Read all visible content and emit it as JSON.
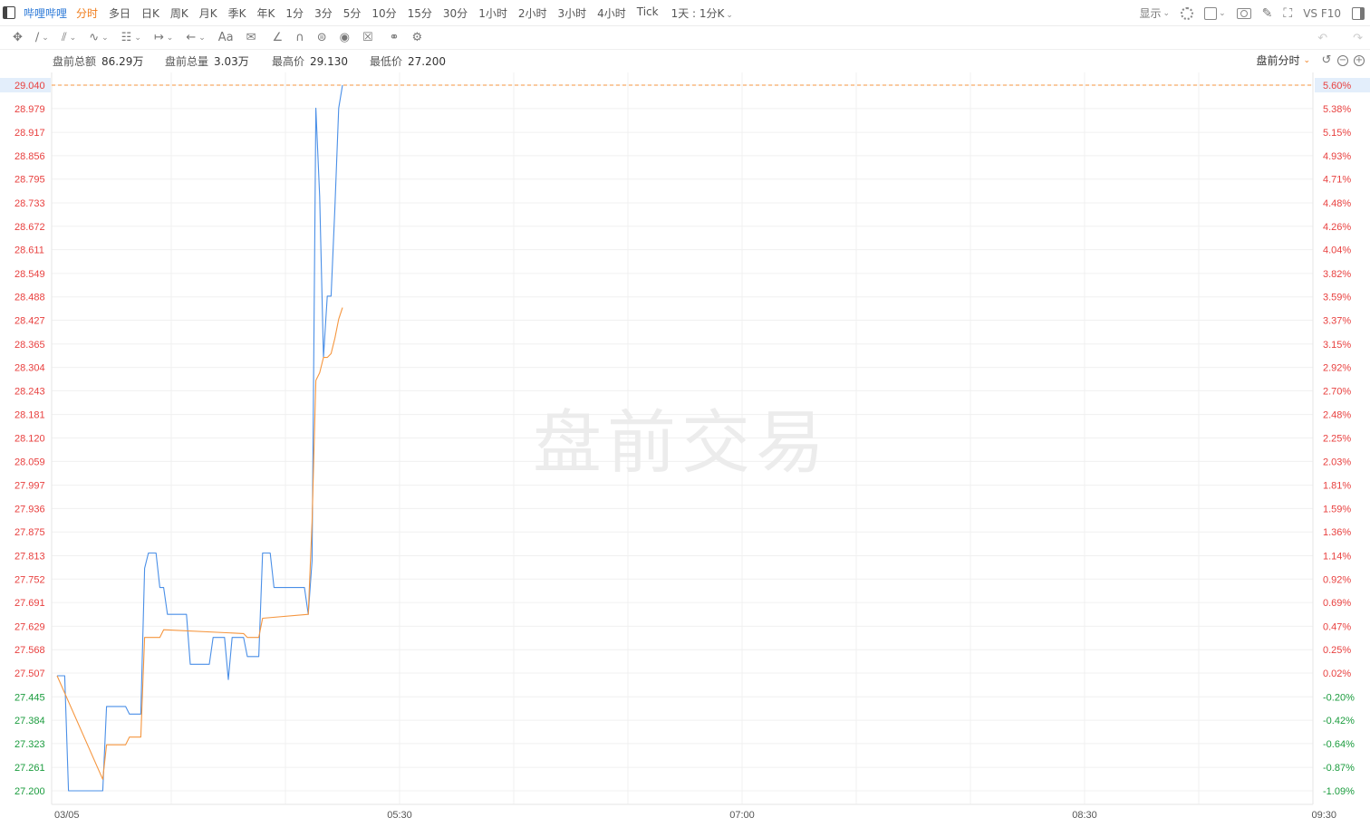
{
  "toolbar": {
    "stock_name": "哔哩哔哩",
    "periods": [
      "分时",
      "多日",
      "日K",
      "周K",
      "月K",
      "季K",
      "年K",
      "1分",
      "3分",
      "5分",
      "10分",
      "15分",
      "30分",
      "1小时",
      "2小时",
      "3小时",
      "4小时",
      "Tick"
    ],
    "active_period": "分时",
    "range_label": "1天 : 1分K",
    "display_label": "显示",
    "vs_f10_label": "VS F10"
  },
  "drawing_toolbar": {
    "text_tool_label": "Aa",
    "icons": [
      "move-icon",
      "line-icon",
      "channel-icon",
      "wave-icon",
      "measure-icon",
      "range-icon",
      "arrow-icon",
      "text-icon",
      "comment-icon",
      "angle-icon",
      "magnet-icon",
      "lock-icon",
      "eye-icon",
      "trash-icon",
      "compare-icon",
      "settings-icon"
    ]
  },
  "info": {
    "amount_label": "盘前总额",
    "amount_value": "86.29万",
    "volume_label": "盘前总量",
    "volume_value": "3.03万",
    "high_label": "最高价",
    "high_value": "29.130",
    "low_label": "最低价",
    "low_value": "27.200",
    "mode_label": "盘前分时"
  },
  "watermark": "盘前交易",
  "colors": {
    "price_line": "#4a8fe7",
    "avg_line": "#f5963f",
    "up": "#e8403f",
    "down": "#1b9c3e",
    "ref_line": "#f5963f",
    "grid": "#f0f0f0",
    "highlight_bg": "#e3eefb"
  },
  "chart_data": {
    "type": "line",
    "title": "",
    "xlabel": "",
    "ylabel": "",
    "prev_close": 27.5,
    "ylim": [
      27.2,
      29.04
    ],
    "xlim": [
      "04:00",
      "09:30"
    ],
    "left_ticks": [
      "29.040",
      "28.979",
      "28.917",
      "28.856",
      "28.795",
      "28.733",
      "28.672",
      "28.611",
      "28.549",
      "28.488",
      "28.427",
      "28.365",
      "28.304",
      "28.243",
      "28.181",
      "28.120",
      "28.059",
      "27.997",
      "27.936",
      "27.875",
      "27.813",
      "27.752",
      "27.691",
      "27.629",
      "27.568",
      "27.507",
      "27.445",
      "27.384",
      "27.323",
      "27.261",
      "27.200"
    ],
    "right_ticks": [
      "5.60%",
      "5.38%",
      "5.15%",
      "4.93%",
      "4.71%",
      "4.48%",
      "4.26%",
      "4.04%",
      "3.82%",
      "3.59%",
      "3.37%",
      "3.15%",
      "2.92%",
      "2.70%",
      "2.48%",
      "2.25%",
      "2.03%",
      "1.81%",
      "1.59%",
      "1.36%",
      "1.14%",
      "0.92%",
      "0.69%",
      "0.47%",
      "0.25%",
      "0.02%",
      "-0.20%",
      "-0.42%",
      "-0.64%",
      "-0.87%",
      "-1.09%"
    ],
    "x_ticks": [
      "03/05",
      "05:30",
      "07:00",
      "08:30",
      "09:30"
    ],
    "current_price_label": "29.040",
    "series": [
      {
        "values": [
          [
            "04:00",
            27.5
          ],
          [
            "04:02",
            27.5
          ],
          [
            "04:03",
            27.2
          ],
          [
            "04:12",
            27.2
          ],
          [
            "04:13",
            27.42
          ],
          [
            "04:18",
            27.42
          ],
          [
            "04:19",
            27.4
          ],
          [
            "04:22",
            27.4
          ],
          [
            "04:23",
            27.78
          ],
          [
            "04:24",
            27.82
          ],
          [
            "04:26",
            27.82
          ],
          [
            "04:27",
            27.73
          ],
          [
            "04:28",
            27.73
          ],
          [
            "04:29",
            27.66
          ],
          [
            "04:34",
            27.66
          ],
          [
            "04:35",
            27.53
          ],
          [
            "04:40",
            27.53
          ],
          [
            "04:41",
            27.6
          ],
          [
            "04:44",
            27.6
          ],
          [
            "04:45",
            27.49
          ],
          [
            "04:46",
            27.6
          ],
          [
            "04:49",
            27.6
          ],
          [
            "04:50",
            27.55
          ],
          [
            "04:53",
            27.55
          ],
          [
            "04:54",
            27.82
          ],
          [
            "04:56",
            27.82
          ],
          [
            "04:57",
            27.73
          ],
          [
            "05:05",
            27.73
          ],
          [
            "05:06",
            27.66
          ],
          [
            "05:07",
            27.8
          ],
          [
            "05:08",
            28.98
          ],
          [
            "05:09",
            28.75
          ],
          [
            "05:10",
            28.33
          ],
          [
            "05:11",
            28.49
          ],
          [
            "05:12",
            28.49
          ],
          [
            "05:13",
            28.72
          ],
          [
            "05:14",
            28.98
          ],
          [
            "05:15",
            29.04
          ]
        ]
      },
      {
        "values": [
          [
            "04:00",
            27.5
          ],
          [
            "04:12",
            27.23
          ],
          [
            "04:13",
            27.32
          ],
          [
            "04:18",
            27.32
          ],
          [
            "04:19",
            27.34
          ],
          [
            "04:22",
            27.34
          ],
          [
            "04:23",
            27.6
          ],
          [
            "04:27",
            27.6
          ],
          [
            "04:28",
            27.62
          ],
          [
            "04:49",
            27.61
          ],
          [
            "04:50",
            27.6
          ],
          [
            "04:53",
            27.6
          ],
          [
            "04:54",
            27.65
          ],
          [
            "05:06",
            27.66
          ],
          [
            "05:07",
            27.9
          ],
          [
            "05:08",
            28.27
          ],
          [
            "05:09",
            28.29
          ],
          [
            "05:10",
            28.33
          ],
          [
            "05:11",
            28.33
          ],
          [
            "05:12",
            28.34
          ],
          [
            "05:13",
            28.38
          ],
          [
            "05:14",
            28.43
          ],
          [
            "05:15",
            28.46
          ]
        ]
      }
    ]
  }
}
